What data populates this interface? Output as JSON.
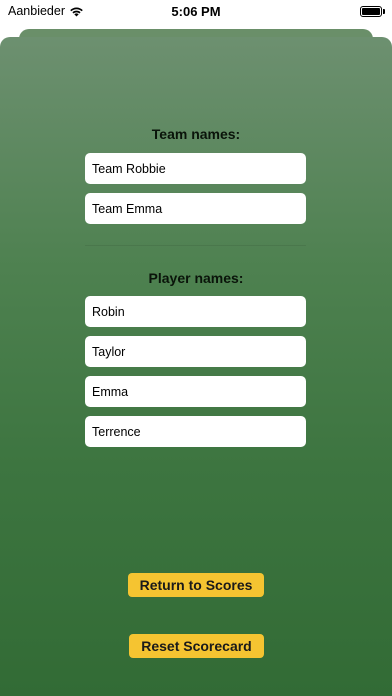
{
  "status_bar": {
    "carrier": "Aanbieder",
    "time": "5:06 PM",
    "battery_level": 1.0
  },
  "team_section": {
    "title": "Team names:",
    "names": [
      "Team Robbie",
      "Team Emma"
    ]
  },
  "player_section": {
    "title": "Player names:",
    "names": [
      "Robin",
      "Taylor",
      "Emma",
      "Terrence"
    ]
  },
  "actions": {
    "return_label": "Return to Scores",
    "reset_label": "Reset Scorecard"
  },
  "colors": {
    "background_top": "#6d9070",
    "background_bottom": "#326b35",
    "button": "#f5c431"
  }
}
